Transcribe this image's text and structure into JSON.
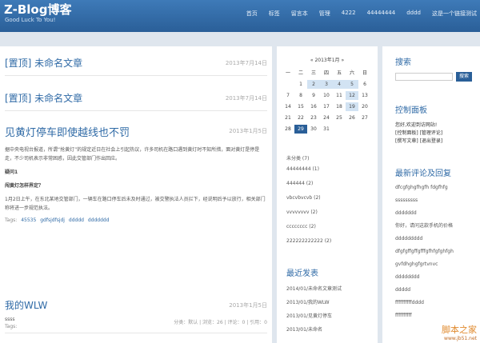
{
  "header": {
    "logo": "Z-Blog博客",
    "slogan": "Good Luck To You!",
    "nav": [
      "首页",
      "标签",
      "留言本",
      "管理",
      "4222",
      "44444444",
      "dddd",
      "这是一个链接测试"
    ]
  },
  "posts": [
    {
      "title": "[置顶] 未命名文章",
      "date": "2013年7月14日"
    },
    {
      "title": "[置顶] 未命名文章",
      "date": "2013年7月14日"
    },
    {
      "title": "见黄灯停车即使越线也不罚",
      "date": "2013年1月5日",
      "body": "据中央电视台报道，所谓“抢黄灯”的规定近日在社会上引起热议，许多司机在路口遇到黄灯时不知所措，面对黄灯是停是走，不少司机表示非常困惑，因此交管部门作出回应。",
      "heading1": "疑问1",
      "heading2": "闯黄灯怎样界定？",
      "para2": "1月2日上午，在东北某地交管部门，一辆车在路口停车后未及时通过，被交警执法人员拦下，经说明后予以放行，相关部门称将进一步规范执法。",
      "tags_label": "Tags:",
      "tags": [
        "45535",
        "gdfsjdfsjdj",
        "ddddd",
        "ddddddd"
      ],
      "meta": "分类：默认 | 浏览：26 | 评论：0 | 引用：0"
    },
    {
      "title": "我的WLW",
      "date": "2013年1月5日",
      "body": "ssss",
      "tags_label": "Tags:"
    }
  ],
  "calendar": {
    "title": "« 2013年1月 »",
    "weekdays": [
      "一",
      "二",
      "三",
      "四",
      "五",
      "六",
      "日"
    ],
    "days": [
      "",
      "1",
      "2",
      "3",
      "4",
      "5",
      "6",
      "7",
      "8",
      "9",
      "10",
      "11",
      "12",
      "13",
      "14",
      "15",
      "16",
      "17",
      "18",
      "19",
      "20",
      "21",
      "22",
      "23",
      "24",
      "25",
      "26",
      "27",
      "28",
      "29",
      "30",
      "31"
    ]
  },
  "categories": {
    "title": "未分类 (7)",
    "items": [
      "44444444 (1)",
      "444444 (2)",
      "vbcvbvcvb (2)",
      "vvvvvvvv (2)",
      "cccccccc (2)",
      "222222222222 (2)"
    ]
  },
  "recent": {
    "title": "最近发表",
    "items": [
      "2014/01/未命名文章测试",
      "2013/01/我的WLW",
      "2013/01/见黄灯停车",
      "2013/01/未命名"
    ]
  },
  "search": {
    "title": "搜索",
    "button": "搜索",
    "placeholder": ""
  },
  "control_panel": {
    "title": "控制面板",
    "lines": [
      "您好,欢迎到访网站!",
      "[控制面板] [管理评论]",
      "[撰写文章] [退出登录]"
    ]
  },
  "comments": {
    "title": "最新评论及回复",
    "items": [
      "dfcgfghgfhgfh fdgfhfg",
      "sssssssss",
      "ddddddd",
      "你好，请问这款手机的价格",
      "ddddddddd",
      "dfgfgffgffgfffgfhfgfghfgh",
      "gvfdhghgfgrtvnvc",
      "dddddddd",
      "ddddd",
      "ffffffffffdddd",
      "ffffffffff"
    ]
  },
  "watermark": {
    "top": "脚本之家",
    "bottom": "www.jb51.net"
  }
}
